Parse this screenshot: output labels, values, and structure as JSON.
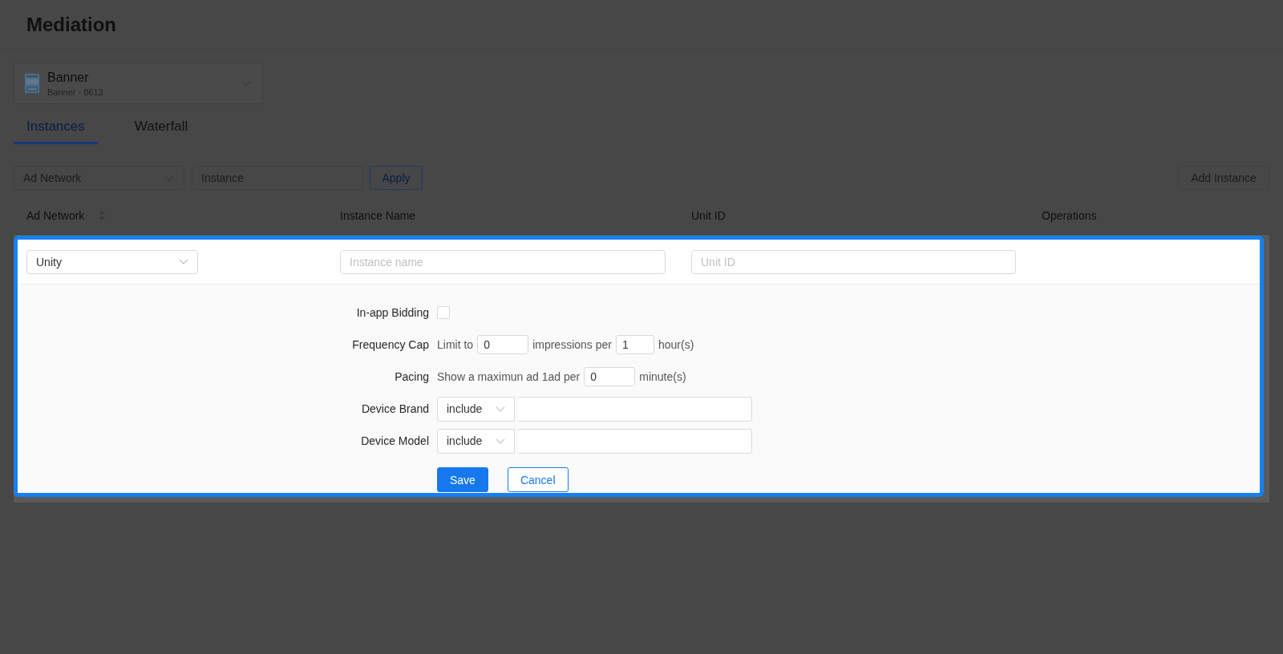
{
  "page": {
    "title": "Mediation"
  },
  "ad_unit": {
    "name": "Banner",
    "subtitle": "Banner · 8613"
  },
  "tabs": [
    {
      "label": "Instances",
      "selected": true
    },
    {
      "label": "Waterfall",
      "selected": false
    }
  ],
  "filters": {
    "ad_network": {
      "placeholder": "Ad Network"
    },
    "instance": {
      "placeholder": "Instance"
    },
    "apply_button": "Apply",
    "add_button": "Add Instance"
  },
  "table": {
    "columns": [
      {
        "label": "Ad Network",
        "sortable": true
      },
      {
        "label": "Instance Name",
        "sortable": false
      },
      {
        "label": "Unit ID",
        "sortable": false
      },
      {
        "label": "Operations",
        "sortable": false
      }
    ]
  },
  "edit_row": {
    "ad_network": {
      "value": "Unity"
    },
    "instance_name": {
      "placeholder": "Instance name"
    },
    "unit_id": {
      "placeholder": "Unit ID"
    },
    "settings": [
      {
        "kind": "checkbox",
        "label": "In-app Bidding",
        "checked": false
      },
      {
        "kind": "sentence",
        "label": "Frequency Cap",
        "parts": [
          {
            "kind": "text",
            "text": "Limit to"
          },
          {
            "kind": "input",
            "value": "0"
          },
          {
            "kind": "text",
            "text": "impressions per"
          },
          {
            "kind": "input",
            "value": "1"
          },
          {
            "kind": "text",
            "text": "hour(s)"
          }
        ]
      },
      {
        "kind": "sentence",
        "label": "Pacing",
        "parts": [
          {
            "kind": "text",
            "text": "Show a maximun ad 1ad per"
          },
          {
            "kind": "input",
            "value": "0"
          },
          {
            "kind": "text",
            "text": "minute(s)"
          }
        ]
      },
      {
        "kind": "filter",
        "label": "Device Brand",
        "mode": "include"
      },
      {
        "kind": "filter",
        "label": "Device Model",
        "mode": "include"
      }
    ],
    "buttons": [
      {
        "kind": "primary",
        "label": "Save"
      },
      {
        "kind": "secondary",
        "label": "Cancel"
      }
    ]
  }
}
